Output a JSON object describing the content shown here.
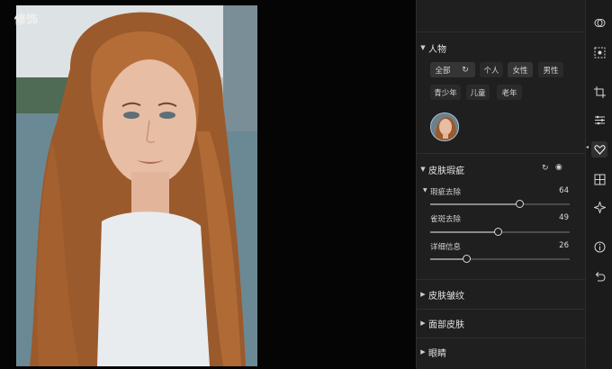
{
  "panel": {
    "title": "修饰",
    "people": {
      "heading": "人物",
      "chips": [
        "全部",
        "个人",
        "女性",
        "男性",
        "青少年",
        "儿童",
        "老年"
      ]
    },
    "skin_blemish": {
      "heading": "皮肤瑕疵",
      "sub_caret": "瑕疵去除",
      "sliders": [
        {
          "label": "瑕疵去除",
          "value": "64",
          "level": 0.64
        },
        {
          "label": "雀斑去除",
          "value": "49",
          "level": 0.49
        },
        {
          "label": "详细信息",
          "value": "26",
          "level": 0.26
        }
      ]
    },
    "collapsed_sections": [
      "皮肤皱纹",
      "面部皮肤",
      "眼睛"
    ]
  },
  "rail_tools": [
    "overlap-circles-icon",
    "focus-frame-icon",
    "crop-icon",
    "sliders-icon",
    "retouch-heart-icon",
    "grid-icon",
    "sparkle-icon",
    "info-icon",
    "undo-icon"
  ],
  "colors": {
    "panel_bg": "#1f1f1f",
    "rail_bg": "#1b1b1b",
    "avatar_ring": "#a9c6dd"
  }
}
